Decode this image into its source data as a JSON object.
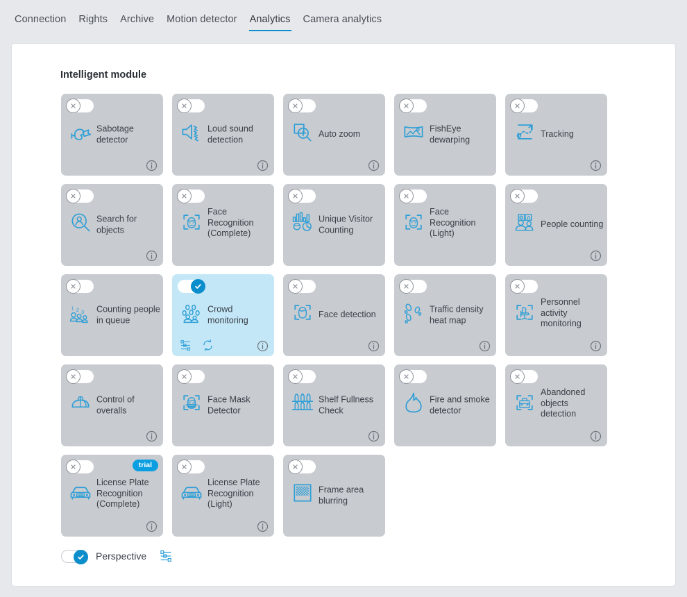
{
  "tabs": [
    {
      "label": "Connection",
      "active": false
    },
    {
      "label": "Rights",
      "active": false
    },
    {
      "label": "Archive",
      "active": false
    },
    {
      "label": "Motion detector",
      "active": false
    },
    {
      "label": "Analytics",
      "active": true
    },
    {
      "label": "Camera analytics",
      "active": false
    }
  ],
  "section": {
    "title": "Intelligent module"
  },
  "colors": {
    "accent": "#0b8ecb",
    "badge": "#0b9ee0",
    "card_bg": "#c8cbd0",
    "card_active_bg": "#c3e7f7",
    "panel_bg": "#ffffff",
    "page_bg": "#e6e8ec",
    "text": "#3b4048"
  },
  "modules": [
    {
      "label": "Sabotage detector",
      "icon": "sabotage-detector-icon",
      "enabled": false,
      "info": true,
      "trial": false,
      "actions": []
    },
    {
      "label": "Loud sound detection",
      "icon": "loud-sound-icon",
      "enabled": false,
      "info": true,
      "trial": false,
      "actions": []
    },
    {
      "label": "Auto zoom",
      "icon": "auto-zoom-icon",
      "enabled": false,
      "info": true,
      "trial": false,
      "actions": []
    },
    {
      "label": "FishEye dewarping",
      "icon": "fisheye-dewarping-icon",
      "enabled": false,
      "info": false,
      "trial": false,
      "actions": []
    },
    {
      "label": "Tracking",
      "icon": "tracking-icon",
      "enabled": false,
      "info": true,
      "trial": false,
      "actions": []
    },
    {
      "label": "Search for objects",
      "icon": "search-objects-icon",
      "enabled": false,
      "info": true,
      "trial": false,
      "actions": []
    },
    {
      "label": "Face Recognition (Complete)",
      "icon": "face-recognition-icon",
      "enabled": false,
      "info": false,
      "trial": false,
      "actions": []
    },
    {
      "label": "Unique Visitor Counting",
      "icon": "unique-visitor-icon",
      "enabled": false,
      "info": false,
      "trial": false,
      "actions": []
    },
    {
      "label": "Face Recognition (Light)",
      "icon": "face-recognition-icon",
      "enabled": false,
      "info": false,
      "trial": false,
      "actions": []
    },
    {
      "label": "People counting",
      "icon": "people-counting-icon",
      "enabled": false,
      "info": true,
      "trial": false,
      "actions": []
    },
    {
      "label": "Counting people in queue",
      "icon": "counting-queue-icon",
      "enabled": false,
      "info": false,
      "trial": false,
      "actions": []
    },
    {
      "label": "Crowd monitoring",
      "icon": "crowd-monitoring-icon",
      "enabled": true,
      "info": true,
      "trial": false,
      "actions": [
        "settings-sliders-icon",
        "sync-refresh-icon"
      ]
    },
    {
      "label": "Face detection",
      "icon": "face-detection-icon",
      "enabled": false,
      "info": true,
      "trial": false,
      "actions": []
    },
    {
      "label": "Traffic density heat map",
      "icon": "footsteps-heatmap-icon",
      "enabled": false,
      "info": true,
      "trial": false,
      "actions": []
    },
    {
      "label": "Personnel activity monitoring",
      "icon": "personnel-activity-icon",
      "enabled": false,
      "info": true,
      "trial": false,
      "actions": []
    },
    {
      "label": "Control of overalls",
      "icon": "hardhat-icon",
      "enabled": false,
      "info": true,
      "trial": false,
      "actions": []
    },
    {
      "label": "Face Mask Detector",
      "icon": "face-mask-icon",
      "enabled": false,
      "info": false,
      "trial": false,
      "actions": []
    },
    {
      "label": "Shelf Fullness Check",
      "icon": "shelf-fullness-icon",
      "enabled": false,
      "info": true,
      "trial": false,
      "actions": []
    },
    {
      "label": "Fire and smoke detector",
      "icon": "fire-smoke-icon",
      "enabled": false,
      "info": false,
      "trial": false,
      "actions": []
    },
    {
      "label": "Abandoned objects detection",
      "icon": "abandoned-object-icon",
      "enabled": false,
      "info": true,
      "trial": false,
      "actions": []
    },
    {
      "label": "License Plate Recognition (Complete)",
      "icon": "license-plate-icon",
      "enabled": false,
      "info": true,
      "trial": true,
      "trial_label": "trial",
      "actions": []
    },
    {
      "label": "License Plate Recognition (Light)",
      "icon": "license-plate-icon",
      "enabled": false,
      "info": true,
      "trial": false,
      "actions": []
    },
    {
      "label": "Frame area blurring",
      "icon": "frame-blur-icon",
      "enabled": false,
      "info": false,
      "trial": false,
      "actions": []
    }
  ],
  "perspective": {
    "label": "Perspective",
    "enabled": true,
    "settings_icon": "settings-sliders-icon"
  }
}
